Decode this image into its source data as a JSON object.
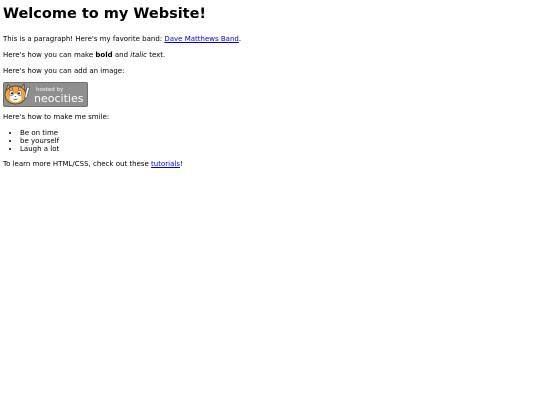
{
  "heading": "Welcome to my Website!",
  "para1": {
    "text": "This is a paragraph! Here's my favorite band: ",
    "band_link": "Dave Matthews Band",
    "end": "."
  },
  "para2": {
    "prefix": "Here's how you can make ",
    "bold": "bold",
    "middle": " and ",
    "italic": "italic",
    "suffix": " text."
  },
  "para3": "Here's how you can add an image:",
  "badge": {
    "line1": "hosted by",
    "line2": "neocities",
    "colors": {
      "bg": "#8f8f8f",
      "text": "#ffffff",
      "cat": "#f3a43a"
    }
  },
  "para4": "Here's how to make me smile:",
  "list": [
    "Be on time",
    "be yourself",
    "Laugh a lot"
  ],
  "para5": {
    "prefix": "To learn more HTML/CSS, check out these ",
    "link": "tutorials",
    "suffix": "!"
  },
  "link_color": "#0000ee"
}
